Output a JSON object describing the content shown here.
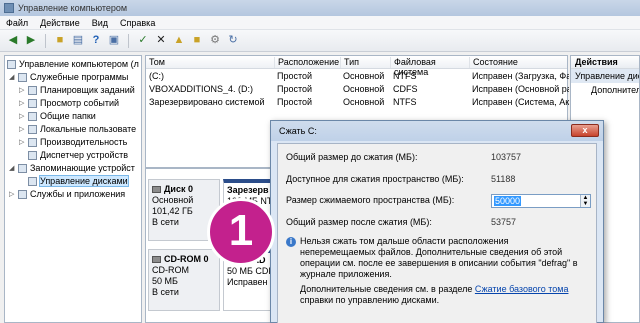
{
  "window": {
    "title": "Управление компьютером"
  },
  "menu": [
    "Файл",
    "Действие",
    "Вид",
    "Справка"
  ],
  "toolbar": {
    "icons": [
      "back-arrow-icon",
      "forward-arrow-icon",
      "up-folder-icon",
      "properties-icon",
      "help-icon",
      "console-icon",
      "check-icon",
      "delete-icon",
      "open-folder-icon",
      "new-folder-icon",
      "settings-icon",
      "refresh-icon"
    ]
  },
  "tree": {
    "items": [
      {
        "label": "Управление компьютером (л",
        "icon": "computer-icon",
        "level": 0
      },
      {
        "label": "Служебные программы",
        "icon": "tools-icon",
        "level": 1
      },
      {
        "label": "Планировщик заданий",
        "icon": "scheduler-icon",
        "level": 2
      },
      {
        "label": "Просмотр событий",
        "icon": "event-viewer-icon",
        "level": 2
      },
      {
        "label": "Общие папки",
        "icon": "shared-folder-icon",
        "level": 2
      },
      {
        "label": "Локальные пользовате",
        "icon": "users-icon",
        "level": 2
      },
      {
        "label": "Производительность",
        "icon": "performance-icon",
        "level": 2
      },
      {
        "label": "Диспетчер устройств",
        "icon": "device-manager-icon",
        "level": 2
      },
      {
        "label": "Запоминающие устройст",
        "icon": "storage-icon",
        "level": 1
      },
      {
        "label": "Управление дисками",
        "icon": "disk-management-icon",
        "level": 2,
        "selected": true
      },
      {
        "label": "Службы и приложения",
        "icon": "services-icon",
        "level": 1
      }
    ]
  },
  "volumes": {
    "columns": [
      "Том",
      "Расположение",
      "Тип",
      "Файловая система",
      "Состояние"
    ],
    "rows": [
      [
        "(C:)",
        "Простой",
        "Основной",
        "NTFS",
        "Исправен (Загрузка, Файл"
      ],
      [
        "VBOXADDITIONS_4. (D:)",
        "Простой",
        "Основной",
        "CDFS",
        "Исправен (Основной разд"
      ],
      [
        "Зарезервировано системой",
        "Простой",
        "Основной",
        "NTFS",
        "Исправен (Система, Акт"
      ]
    ]
  },
  "disks": [
    {
      "name": "Диск 0",
      "lines": [
        "Основной",
        "101,42 ГБ",
        "В сети"
      ],
      "partition": [
        "Зарезерв",
        "100 МБ NTF"
      ]
    },
    {
      "name": "CD-ROM 0",
      "lines": [
        "CD-ROM",
        "50 МБ",
        "В сети"
      ],
      "partition": [
        "VBOXAD",
        "50 МБ CDF",
        "Исправен (О"
      ]
    }
  ],
  "actions": {
    "header": "Действия",
    "items": [
      "Управление диск",
      "Дополнител"
    ]
  },
  "dialog": {
    "title": "Сжать C:",
    "close_label": "x",
    "total_size_label": "Общий размер до сжатия (МБ):",
    "total_size_value": "103757",
    "available_label": "Доступное для сжатия пространство (МБ):",
    "available_value": "51188",
    "shrink_label": "Размер сжимаемого пространства (МБ):",
    "shrink_value": "50000",
    "after_label": "Общий размер после сжатия (МБ):",
    "after_value": "53757",
    "info_text": "Нельзя сжать том дальше области расположения неперемещаемых файлов. Дополнительные сведения об этой операции см. после ее завершения в описании события \"defrag\" в журнале приложения.",
    "more_prefix": "Дополнительные сведения см. в разделе ",
    "more_link": "Сжатие базового тома",
    "more_suffix": " справки по управлению дисками."
  },
  "marker": {
    "label": "1"
  },
  "colors": {
    "marker": "#c3218d",
    "selection": "#3399ff",
    "link": "#0645ad"
  }
}
